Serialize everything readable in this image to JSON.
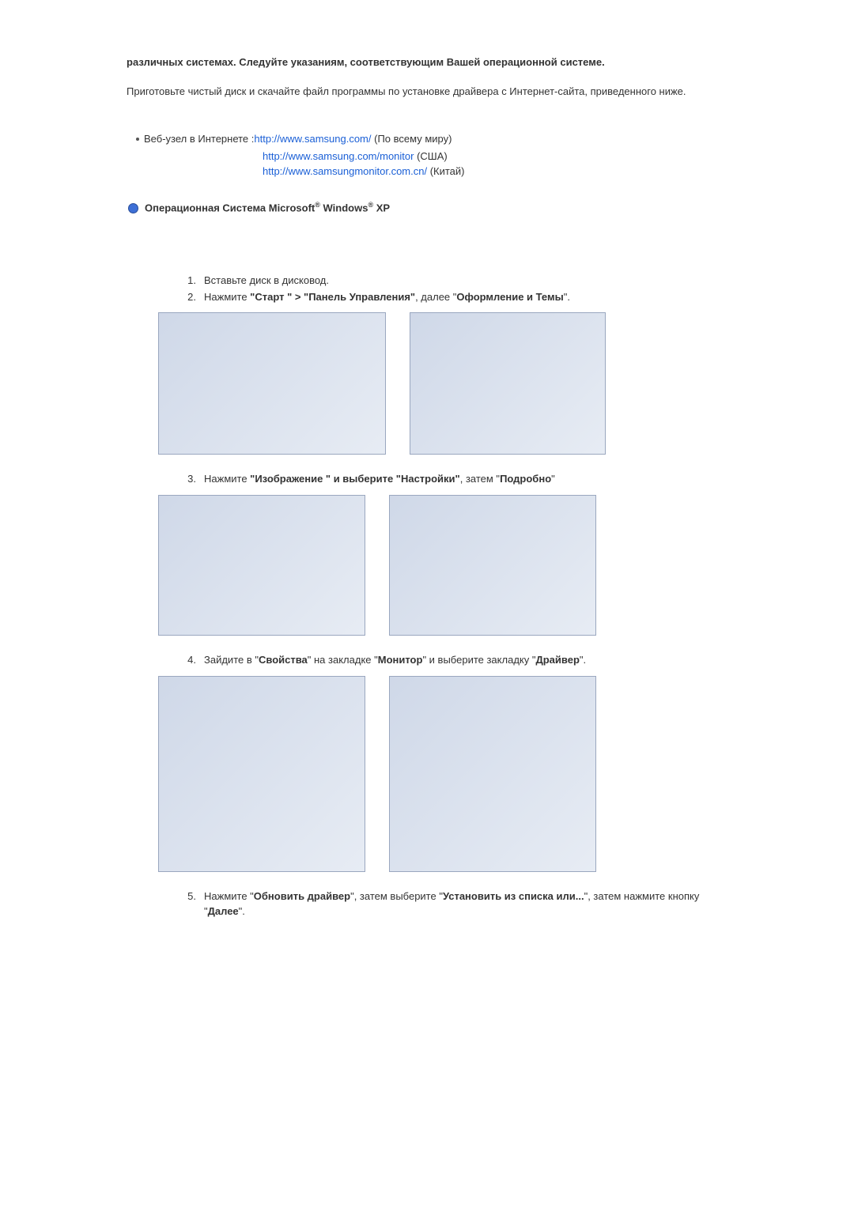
{
  "intro": {
    "para1_bold": "различных системах. Следуйте указаниям, соответствующим Вашей операционной системе.",
    "para2": "Приготовьте чистый диск и скачайте файл программы по установке драйвера с Интернет-сайта, приведенного ниже."
  },
  "links": {
    "bullet_text_pre": "Веб-узел в Интернете :",
    "link1": "http://www.samsung.com/",
    "link1_after": " (По всему миру)",
    "link2": "http://www.samsung.com/monitor",
    "link2_after": " (США)",
    "link3": "http://www.samsungmonitor.com.cn/",
    "link3_after": " (Китай)"
  },
  "heading": {
    "pre": "Операционная Система Microsoft",
    "reg1": "®",
    "mid": " Windows",
    "reg2": "®",
    "post": " XP"
  },
  "steps": {
    "s1_num": "1.",
    "s1": "Вставьте диск в дисковод.",
    "s2_num": "2.",
    "s2_pre": "Нажмите ",
    "s2_b1": "\"Старт \" > \"Панель Управления\"",
    "s2_mid": ", далее \"",
    "s2_b2": "Оформление и Темы",
    "s2_post": "\".",
    "s3_num": "3.",
    "s3_pre": "Нажмите ",
    "s3_b1": "\"Изображение \" и выберите \"Настройки\"",
    "s3_mid": ", затем \"",
    "s3_b2": "Подробно",
    "s3_post": "\"",
    "s4_num": "4.",
    "s4_pre": "Зайдите в \"",
    "s4_b1": "Свойства",
    "s4_mid1": "\" на закладке \"",
    "s4_b2": "Монитор",
    "s4_mid2": "\" и выберите закладку \"",
    "s4_b3": "Драйвер",
    "s4_post": "\".",
    "s5_num": "5.",
    "s5_pre": "Нажмите \"",
    "s5_b1": "Обновить драйвер",
    "s5_mid1": "\", затем выберите \"",
    "s5_b2": "Установить из списка или...",
    "s5_mid2": "\", затем нажмите кнопку \"",
    "s5_b3": "Далее",
    "s5_post": "\"."
  }
}
